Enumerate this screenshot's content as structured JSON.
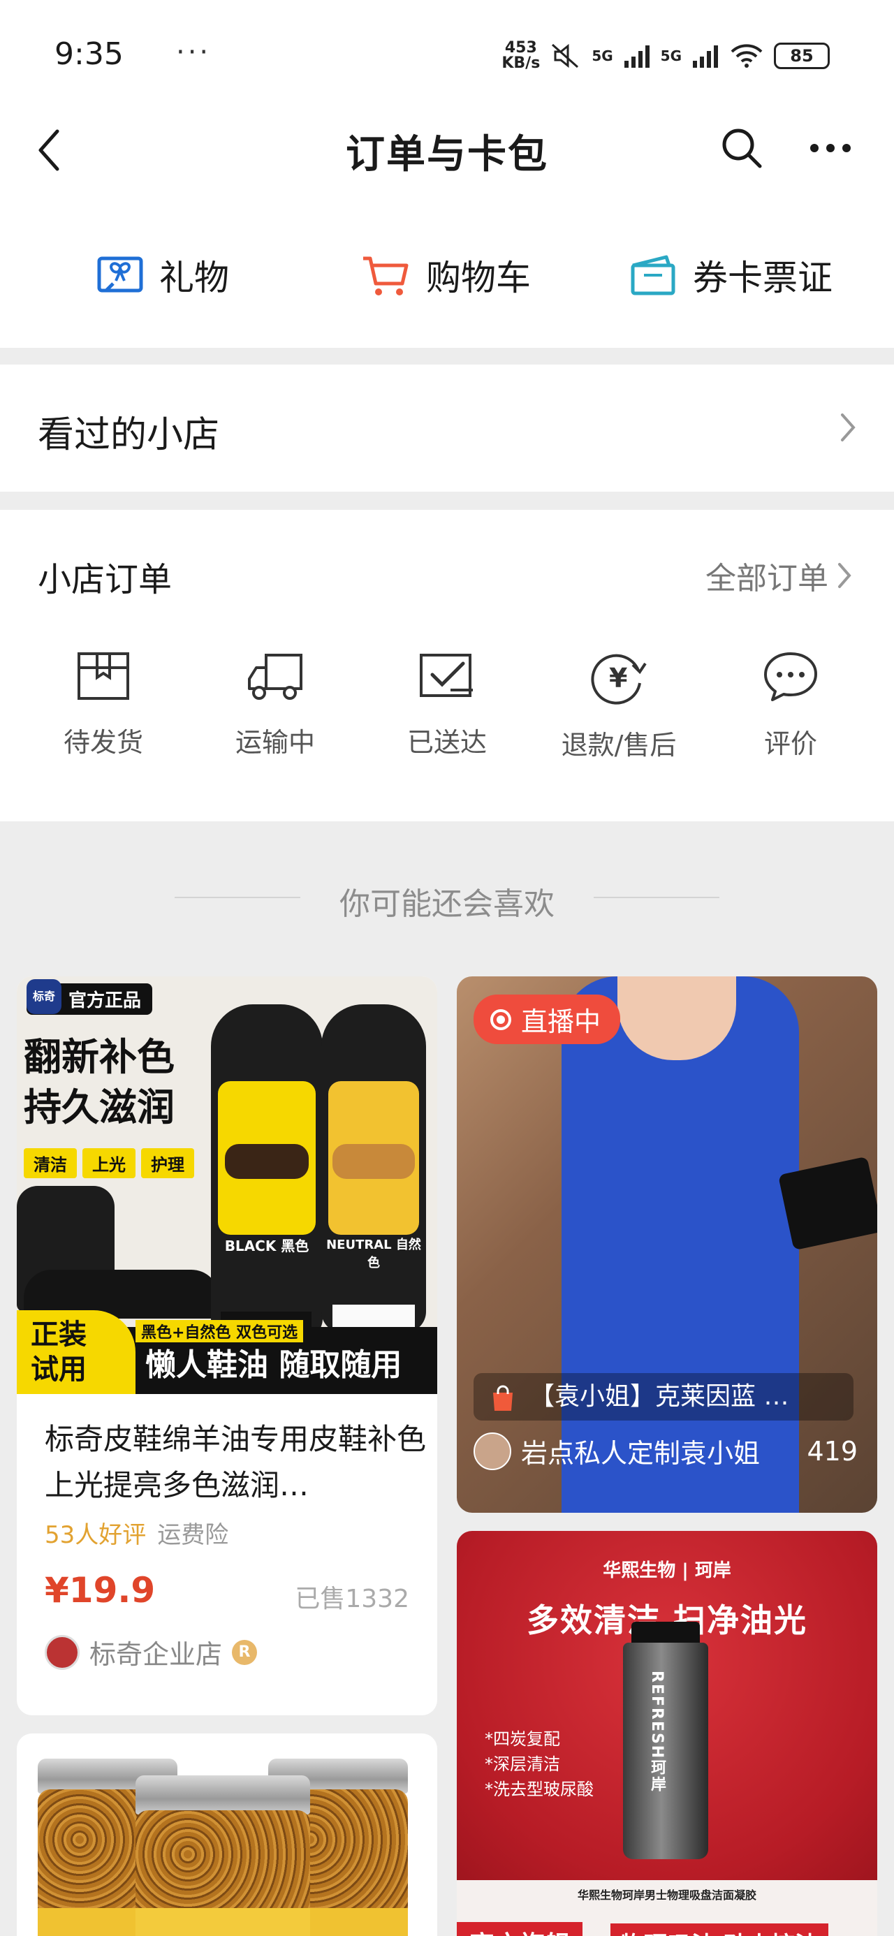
{
  "status_bar": {
    "time": "9:35",
    "dots": "···",
    "net_speed_value": "453",
    "net_speed_unit": "KB/s",
    "signal1": "5G",
    "signal2": "5G",
    "battery": "85"
  },
  "nav": {
    "title": "订单与卡包"
  },
  "quick_links": [
    {
      "label": "礼物",
      "icon": "gift-icon",
      "color": "#1f6fd6"
    },
    {
      "label": "购物车",
      "icon": "cart-icon",
      "color": "#ef5a3c"
    },
    {
      "label": "券卡票证",
      "icon": "card-icon",
      "color": "#2aa8c4"
    }
  ],
  "visited_shops": {
    "label": "看过的小店"
  },
  "orders": {
    "title": "小店订单",
    "all_label": "全部订单",
    "items": [
      {
        "label": "待发货",
        "icon": "box-icon"
      },
      {
        "label": "运输中",
        "icon": "truck-icon"
      },
      {
        "label": "已送达",
        "icon": "delivered-icon"
      },
      {
        "label": "退款/售后",
        "icon": "refund-icon"
      },
      {
        "label": "评价",
        "icon": "comment-icon"
      }
    ]
  },
  "recommend": {
    "title": "你可能还会喜欢"
  },
  "product1": {
    "badge": "官方正品",
    "brand_logo": "标奇",
    "headline1": "翻新补色",
    "headline2": "持久滋润",
    "tags": [
      "清洁",
      "上光",
      "护理"
    ],
    "bottle_black": "BLACK 黑色",
    "bottle_neutral": "NEUTRAL 自然色",
    "promo_corner1": "正装",
    "promo_corner2": "试用",
    "promo_sub": "黑色+自然色 双色可选",
    "promo_main": "懒人鞋油 随取随用",
    "name": "标奇皮鞋绵羊油专用皮鞋补色上光提亮多色滋润…",
    "rating": "53人好评",
    "insurance": "运费险",
    "price": "¥19.9",
    "sold": "已售1332",
    "shop": "标奇企业店",
    "shop_badge": "R"
  },
  "live_card": {
    "badge": "直播中",
    "title": "【袁小姐】克莱因蓝 …",
    "author": "岩点私人定制袁小姐",
    "count": "419"
  },
  "ad_card": {
    "brand": "华熙生物 | 珂岸",
    "headline": "多效清洁 扫净油光",
    "features": [
      "*四炭复配",
      "*深层清洁",
      "*洗去型玻尿酸"
    ],
    "tube_text": "REFRESH珂岸",
    "small_text": "华熙生物珂岸男士物理吸盘洁面凝胶",
    "flagship": "官方旗舰",
    "slogan": "物理吸油 劲爽控油"
  }
}
